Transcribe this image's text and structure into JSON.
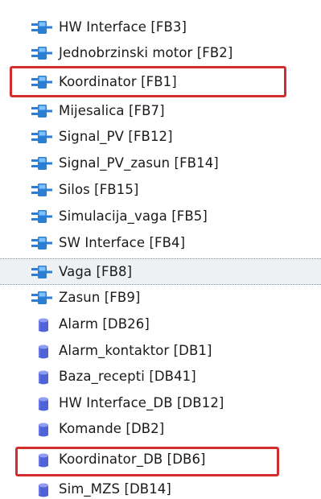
{
  "tree": {
    "items": [
      {
        "label": "HW Interface [FB3]",
        "icon": "function-block-icon"
      },
      {
        "label": "Jednobrzinski motor [FB2]",
        "icon": "function-block-icon"
      },
      {
        "label": "Koordinator [FB1]",
        "icon": "function-block-icon"
      },
      {
        "label": "Mijesalica [FB7]",
        "icon": "function-block-icon"
      },
      {
        "label": "Signal_PV [FB12]",
        "icon": "function-block-icon"
      },
      {
        "label": "Signal_PV_zasun [FB14]",
        "icon": "function-block-icon"
      },
      {
        "label": "Silos [FB15]",
        "icon": "function-block-icon"
      },
      {
        "label": "Simulacija_vaga [FB5]",
        "icon": "function-block-icon"
      },
      {
        "label": "SW Interface [FB4]",
        "icon": "function-block-icon"
      },
      {
        "label": "Vaga [FB8]",
        "icon": "function-block-icon"
      },
      {
        "label": "Zasun [FB9]",
        "icon": "function-block-icon"
      },
      {
        "label": "Alarm [DB26]",
        "icon": "data-block-icon"
      },
      {
        "label": "Alarm_kontaktor [DB1]",
        "icon": "data-block-icon"
      },
      {
        "label": "Baza_recepti [DB41]",
        "icon": "data-block-icon"
      },
      {
        "label": "HW Interface_DB [DB12]",
        "icon": "data-block-icon"
      },
      {
        "label": "Komande [DB2]",
        "icon": "data-block-icon"
      },
      {
        "label": "Koordinator_DB [DB6]",
        "icon": "data-block-icon"
      },
      {
        "label": "Sim_MZS [DB14]",
        "icon": "data-block-icon"
      }
    ]
  },
  "colors": {
    "highlight": "#d42d2d",
    "selected_row": "#eef1f4",
    "fb_icon": "#2a7fd4",
    "db_icon": "#4f62d6"
  }
}
